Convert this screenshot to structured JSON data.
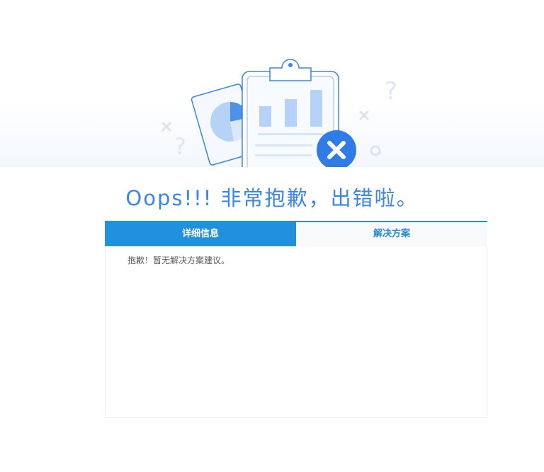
{
  "headline": "Oops!!! 非常抱歉，出错啦。",
  "tabs": [
    {
      "label": "详细信息",
      "active": true
    },
    {
      "label": "解决方案",
      "active": false
    }
  ],
  "content": {
    "message": "抱歉！暂无解决方案建议。"
  },
  "icons": {
    "illustration": "error-clipboard-illustration",
    "error_badge": "close-icon"
  },
  "colors": {
    "accent": "#2191dd",
    "headline": "#3a86e8",
    "error_badge": "#2f7ce6"
  }
}
